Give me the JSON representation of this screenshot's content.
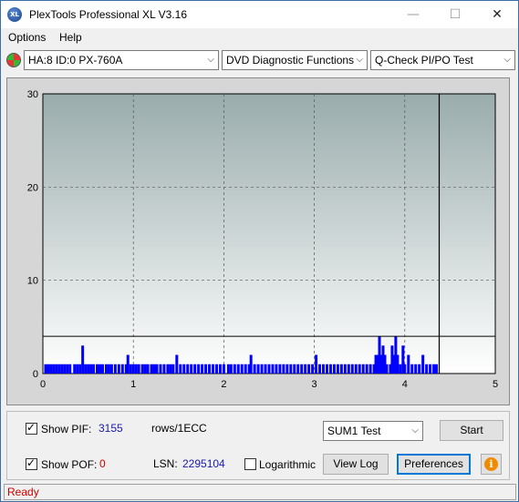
{
  "window": {
    "title": "PlexTools Professional XL V3.16",
    "app_icon_text": "XL",
    "min_glyph": "—",
    "max_glyph": "☐",
    "close_glyph": "✕"
  },
  "menu": {
    "options_label": "Options",
    "help_label": "Help"
  },
  "toolbar": {
    "drive": "HA:8 ID:0  PX-760A",
    "function": "DVD Diagnostic Functions",
    "test": "Q-Check PI/PO Test",
    "dropdown_glyph": "⌵"
  },
  "chart_data": {
    "type": "bar",
    "xlim": [
      0,
      5
    ],
    "ylim": [
      0,
      30
    ],
    "x_ticks": [
      "0",
      "1",
      "2",
      "3",
      "4",
      "5"
    ],
    "y_ticks": [
      "0",
      "10",
      "20",
      "30"
    ],
    "threshold_line": 4,
    "end_marker_x": 4.38,
    "grid": true,
    "series": [
      {
        "color": "#0000ff",
        "points": [
          [
            0.03,
            1
          ],
          [
            0.06,
            1
          ],
          [
            0.09,
            1
          ],
          [
            0.12,
            1
          ],
          [
            0.15,
            1
          ],
          [
            0.18,
            1
          ],
          [
            0.21,
            1
          ],
          [
            0.24,
            1
          ],
          [
            0.27,
            1
          ],
          [
            0.3,
            1
          ],
          [
            0.35,
            1
          ],
          [
            0.38,
            1
          ],
          [
            0.41,
            1
          ],
          [
            0.44,
            3
          ],
          [
            0.47,
            1
          ],
          [
            0.5,
            1
          ],
          [
            0.53,
            1
          ],
          [
            0.56,
            1
          ],
          [
            0.6,
            1
          ],
          [
            0.63,
            1
          ],
          [
            0.66,
            1
          ],
          [
            0.7,
            1
          ],
          [
            0.73,
            1
          ],
          [
            0.76,
            1
          ],
          [
            0.8,
            1
          ],
          [
            0.84,
            1
          ],
          [
            0.88,
            1
          ],
          [
            0.92,
            1
          ],
          [
            0.94,
            2
          ],
          [
            0.97,
            1
          ],
          [
            1.0,
            1
          ],
          [
            1.03,
            1
          ],
          [
            1.06,
            1
          ],
          [
            1.1,
            1
          ],
          [
            1.13,
            1
          ],
          [
            1.16,
            1
          ],
          [
            1.2,
            1
          ],
          [
            1.23,
            1
          ],
          [
            1.26,
            1
          ],
          [
            1.3,
            1
          ],
          [
            1.34,
            1
          ],
          [
            1.38,
            1
          ],
          [
            1.41,
            1
          ],
          [
            1.44,
            1
          ],
          [
            1.48,
            2
          ],
          [
            1.52,
            1
          ],
          [
            1.56,
            1
          ],
          [
            1.6,
            1
          ],
          [
            1.64,
            1
          ],
          [
            1.68,
            1
          ],
          [
            1.72,
            1
          ],
          [
            1.76,
            1
          ],
          [
            1.8,
            1
          ],
          [
            1.84,
            1
          ],
          [
            1.88,
            1
          ],
          [
            1.92,
            1
          ],
          [
            1.96,
            1
          ],
          [
            2.0,
            1
          ],
          [
            2.05,
            1
          ],
          [
            2.08,
            1
          ],
          [
            2.12,
            1
          ],
          [
            2.16,
            1
          ],
          [
            2.2,
            1
          ],
          [
            2.24,
            1
          ],
          [
            2.28,
            1
          ],
          [
            2.3,
            2
          ],
          [
            2.34,
            1
          ],
          [
            2.38,
            1
          ],
          [
            2.42,
            1
          ],
          [
            2.46,
            1
          ],
          [
            2.5,
            1
          ],
          [
            2.54,
            1
          ],
          [
            2.58,
            1
          ],
          [
            2.62,
            1
          ],
          [
            2.66,
            1
          ],
          [
            2.7,
            1
          ],
          [
            2.74,
            1
          ],
          [
            2.78,
            1
          ],
          [
            2.82,
            1
          ],
          [
            2.86,
            1
          ],
          [
            2.9,
            1
          ],
          [
            2.94,
            1
          ],
          [
            2.98,
            1
          ],
          [
            3.02,
            2
          ],
          [
            3.06,
            1
          ],
          [
            3.1,
            1
          ],
          [
            3.14,
            1
          ],
          [
            3.18,
            1
          ],
          [
            3.22,
            1
          ],
          [
            3.26,
            1
          ],
          [
            3.3,
            1
          ],
          [
            3.34,
            1
          ],
          [
            3.38,
            1
          ],
          [
            3.42,
            1
          ],
          [
            3.46,
            1
          ],
          [
            3.5,
            1
          ],
          [
            3.54,
            1
          ],
          [
            3.58,
            1
          ],
          [
            3.62,
            1
          ],
          [
            3.66,
            1
          ],
          [
            3.68,
            2
          ],
          [
            3.7,
            2
          ],
          [
            3.72,
            4
          ],
          [
            3.74,
            2
          ],
          [
            3.76,
            3
          ],
          [
            3.78,
            2
          ],
          [
            3.8,
            1
          ],
          [
            3.84,
            1
          ],
          [
            3.86,
            3
          ],
          [
            3.88,
            2
          ],
          [
            3.9,
            4
          ],
          [
            3.92,
            2
          ],
          [
            3.95,
            1
          ],
          [
            3.98,
            3
          ],
          [
            4.0,
            1
          ],
          [
            4.04,
            2
          ],
          [
            4.08,
            1
          ],
          [
            4.12,
            1
          ],
          [
            4.16,
            1
          ],
          [
            4.2,
            2
          ],
          [
            4.24,
            1
          ],
          [
            4.28,
            1
          ],
          [
            4.32,
            1
          ],
          [
            4.35,
            1
          ]
        ]
      }
    ]
  },
  "controls": {
    "show_pif_label": "Show PIF:",
    "pif_value": "3155",
    "pif_unit": "rows/1ECC",
    "show_pof_label": "Show POF:",
    "pof_value": "0",
    "lsn_label": "LSN:",
    "lsn_value": "2295104",
    "logarithmic_label": "Logarithmic",
    "sum_test": "SUM1 Test",
    "start_button": "Start",
    "view_log_button": "View Log",
    "preferences_button": "Preferences",
    "info_glyph": "i",
    "pif_checked": true,
    "pof_checked": true,
    "log_checked": false
  },
  "status": {
    "text": "Ready"
  }
}
